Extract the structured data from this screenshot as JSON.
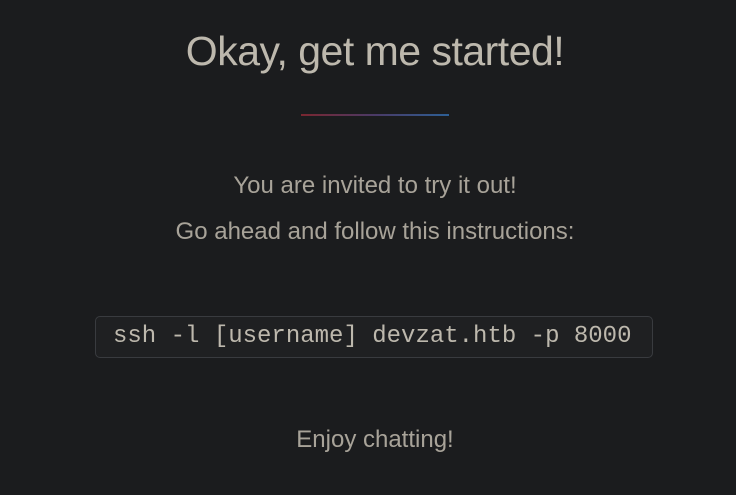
{
  "section": {
    "heading": "Okay, get me started!",
    "invite_line": "You are invited to try it out!",
    "instruction_line": "Go ahead and follow this instructions:",
    "command": "ssh -l [username] devzat.htb -p 8000",
    "closing_line": "Enjoy chatting!"
  },
  "colors": {
    "background": "#1b1c1e",
    "divider_start": "#7a2630",
    "divider_end": "#2d5f95"
  }
}
